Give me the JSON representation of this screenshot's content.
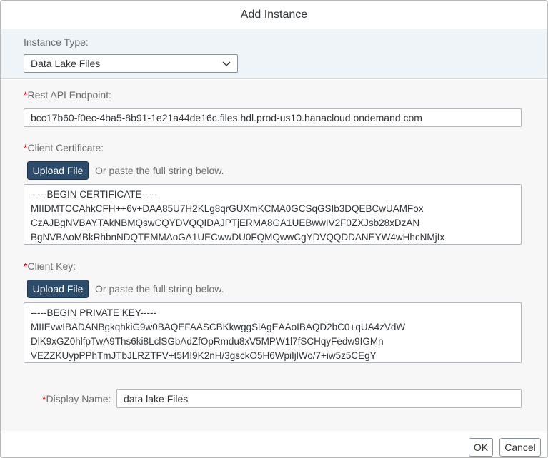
{
  "dialog": {
    "title": "Add Instance"
  },
  "instance_type": {
    "label": "Instance Type:",
    "selected": "Data Lake Files"
  },
  "rest_api": {
    "required_mark": "*",
    "label": "Rest API Endpoint:",
    "value": "bcc17b60-f0ec-4ba5-8b91-1e21a44de16c.files.hdl.prod-us10.hanacloud.ondemand.com"
  },
  "client_certificate": {
    "required_mark": "*",
    "label": "Client Certificate:",
    "upload_label": "Upload File",
    "hint": "Or paste the full string below.",
    "lines": [
      "-----BEGIN CERTIFICATE-----",
      "MIIDMTCCAhkCFH++6v+DAA85U7H2KLg8qrGUXmKCMA0GCSqGSIb3DQEBCwUAMFox",
      "CzAJBgNVBAYTAkNBMQswCQYDVQQIDAJPTjERMA8GA1UEBwwIV2F0ZXJsb28xDzAN",
      "BgNVBAoMBkRhbnNDQTEMMAoGA1UECwwDU0FQMQwwCgYDVQQDDANEYW4wHhcNMjIx"
    ]
  },
  "client_key": {
    "required_mark": "*",
    "label": "Client Key:",
    "upload_label": "Upload File",
    "hint": "Or paste the full string below.",
    "lines": [
      "-----BEGIN PRIVATE KEY-----",
      "MIIEvwIBADANBgkqhkiG9w0BAQEFAASCBKkwggSlAgEAAoIBAQD2bC0+qUA4zVdW",
      "DlK9xGZ0hlfpTwA9Ths6ki8LclSGbAdZfOpRmdu8xV5MPW1l7fSCHqyFedw9IGMn",
      "VEZZKUypPPhTmJTbJLRZTFV+t5l4I9K2nH/3gsckO5H6WpiIjlWo/7+iw5z5CEgY"
    ]
  },
  "display_name": {
    "required_mark": "*",
    "label": "Display Name:",
    "value": "data lake Files"
  },
  "footer": {
    "ok_label": "OK",
    "cancel_label": "Cancel"
  },
  "icons": {
    "dropdown": "chevron-down-icon"
  },
  "colors": {
    "upload_button": "#2d4c6b",
    "required": "#bb0000",
    "type_section_bg": "#eff4f9"
  }
}
